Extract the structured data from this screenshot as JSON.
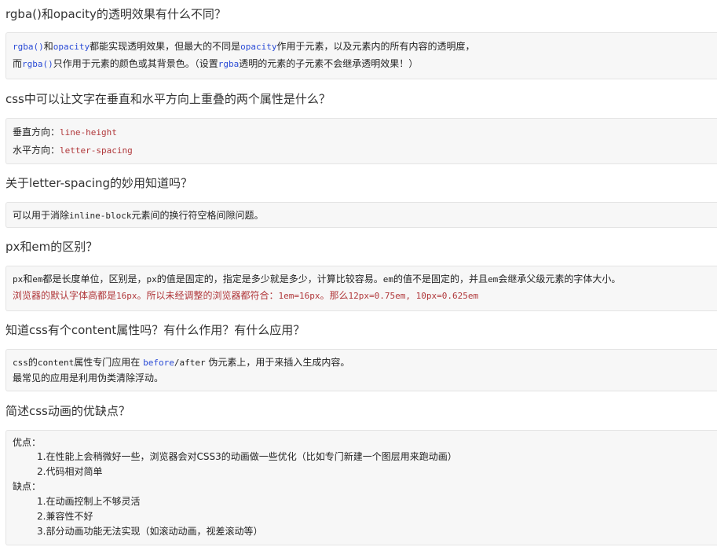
{
  "q1": {
    "title": "rgba()和opacity的透明效果有什么不同？",
    "l1": {
      "a": "rgba()",
      "b": "和",
      "c": "opacity",
      "d": "都能实现透明效果，但最大的不同是",
      "e": "opacity",
      "f": "作用于元素，以及元素内的所有内容的透明度，"
    },
    "l2": {
      "a": "而",
      "b": "rgba()",
      "c": "只作用于元素的颜色或其背景色。（设置",
      "d": "rgba",
      "e": "透明的元素的子元素不会继承透明效果！）"
    }
  },
  "q2": {
    "title": "css中可以让文字在垂直和水平方向上重叠的两个属性是什么？",
    "l1": {
      "a": "垂直方向：",
      "b": "line-height"
    },
    "l2": {
      "a": "水平方向：",
      "b": "letter-spacing"
    }
  },
  "q3": {
    "title": "关于letter-spacing的妙用知道吗？",
    "l1": {
      "a": "可以用于消除",
      "b": "inline-block",
      "c": "元素间的换行符空格间隙问题。"
    }
  },
  "q4": {
    "title": "px和em的区别？",
    "l1": {
      "a": "px",
      "b": "和",
      "c": "em",
      "d": "都是长度单位，区别是，",
      "e": "px",
      "f": "的值是固定的，指定是多少就是多少，计算比较容易。",
      "g": "em",
      "h": "的值不是固定的，并且",
      "i": "em",
      "j": "会继承父级元素的字体大小。"
    },
    "l2": {
      "a": "浏览器的默认字体高都是",
      "b": "16px",
      "c": "。所以未经调整的浏览器都符合：",
      "d": "1em=16px",
      "e": "。那么",
      "f": "12px=0.75em, 10px=0.625em"
    }
  },
  "q5": {
    "title": "知道css有个content属性吗？有什么作用？有什么应用？",
    "l1": {
      "a": "css",
      "b": "的",
      "c": "content",
      "d": "属性专门应用在 ",
      "e": "before",
      "f": "/",
      "g": "after",
      "h": " 伪元素上，用于来插入生成内容。"
    },
    "l2": {
      "a": "最常见的应用是利用伪类清除浮动。"
    }
  },
  "q6": {
    "title": "简述css动画的优缺点？",
    "pros_label": "优点：",
    "pros": [
      "1.在性能上会稍微好一些，浏览器会对CSS3的动画做一些优化（比如专门新建一个图层用来跑动画）",
      "2.代码相对简单"
    ],
    "cons_label": "缺点：",
    "cons": [
      "1.在动画控制上不够灵活",
      "2.兼容性不好",
      "3.部分动画功能无法实现（如滚动动画，视差滚动等）"
    ]
  }
}
